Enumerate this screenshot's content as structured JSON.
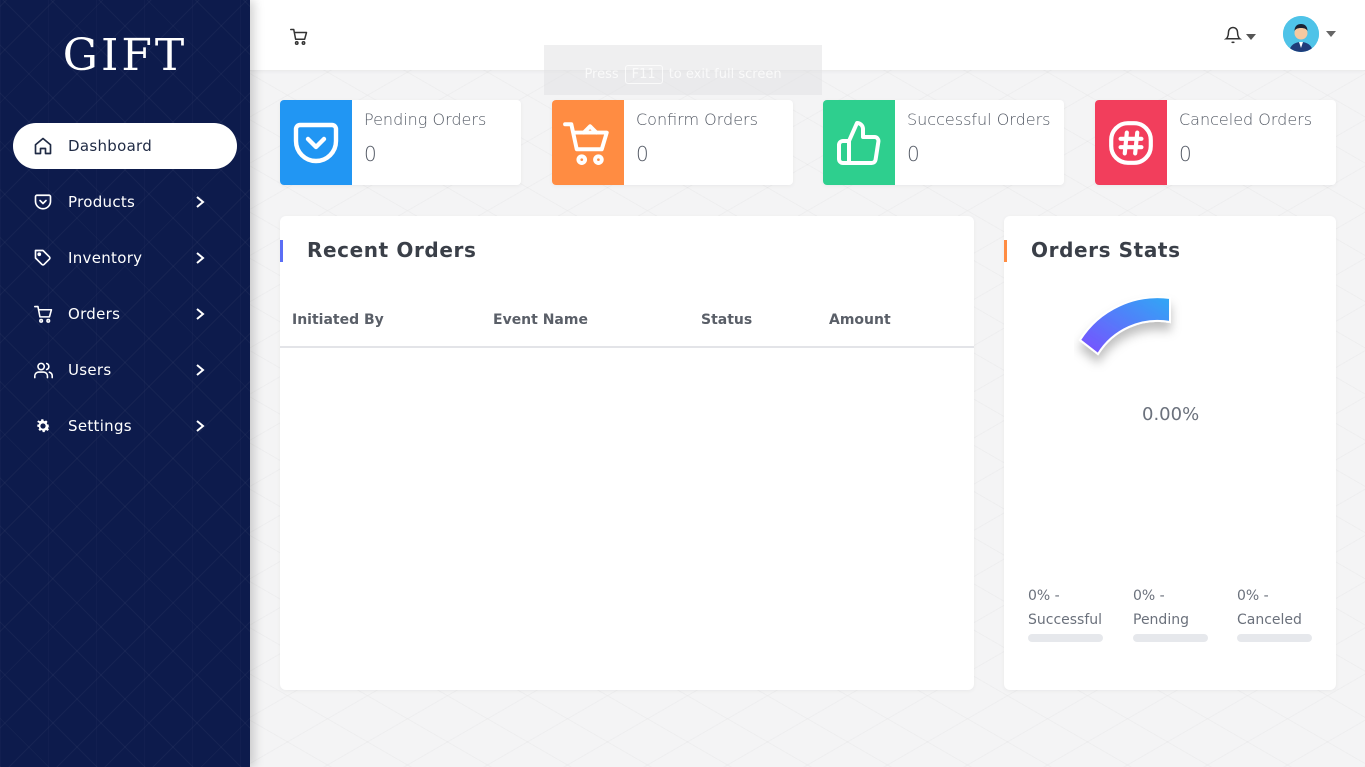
{
  "app": {
    "logo": "GIFT"
  },
  "sidebar": {
    "items": [
      {
        "label": "Dashboard",
        "icon": "home-icon",
        "active": true
      },
      {
        "label": "Products",
        "icon": "pocket-icon"
      },
      {
        "label": "Inventory",
        "icon": "tag-icon"
      },
      {
        "label": "Orders",
        "icon": "cart-icon"
      },
      {
        "label": "Users",
        "icon": "users-icon"
      },
      {
        "label": "Settings",
        "icon": "gear-icon"
      }
    ]
  },
  "topbar": {
    "notification_count": "0",
    "fullscreen_hint": {
      "before": "Press",
      "key": "F11",
      "after": "to exit full screen"
    }
  },
  "stats": [
    {
      "title": "Pending Orders",
      "value": "0",
      "color": "#2196f3",
      "icon": "pocket-icon"
    },
    {
      "title": "Confirm Orders",
      "value": "0",
      "color": "#ff8c42",
      "icon": "cart-icon"
    },
    {
      "title": "Successful Orders",
      "value": "0",
      "color": "#2ecf8e",
      "icon": "thumbs-up-icon"
    },
    {
      "title": "Canceled Orders",
      "value": "0",
      "color": "#f23e5c",
      "icon": "hash-icon"
    }
  ],
  "recent_orders": {
    "title": "Recent Orders",
    "accent": "#5b6ef5",
    "columns": [
      "Initiated By",
      "Event Name",
      "Status",
      "Amount"
    ],
    "rows": []
  },
  "orders_stats": {
    "title": "Orders Stats",
    "accent": "#ff8c42",
    "percent": "0.00%",
    "breakdown": [
      {
        "value": "0% -",
        "label": "Successful",
        "fraction": 0
      },
      {
        "value": "0% -",
        "label": "Pending",
        "fraction": 0
      },
      {
        "value": "0% -",
        "label": "Canceled",
        "fraction": 0
      }
    ]
  }
}
